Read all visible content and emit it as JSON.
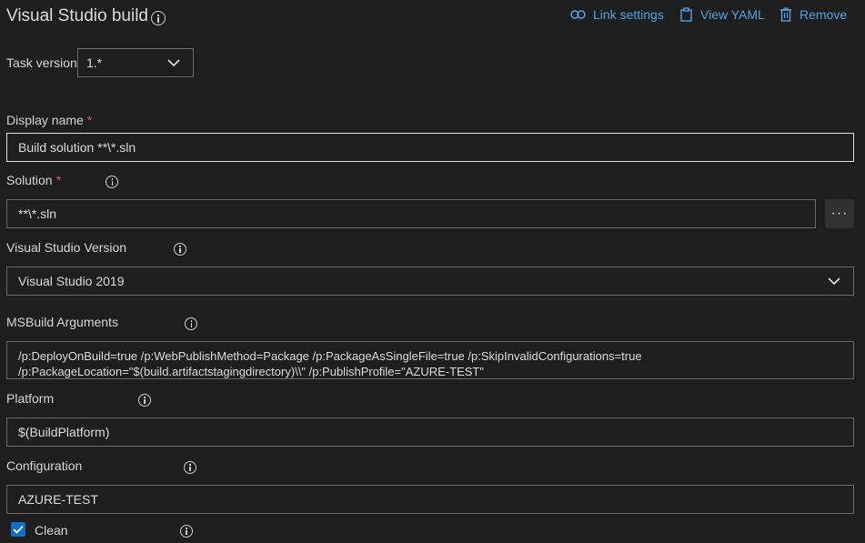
{
  "header": {
    "title": "Visual Studio build",
    "link_settings": "Link settings",
    "view_yaml": "View YAML",
    "remove": "Remove"
  },
  "task_version": {
    "label": "Task version",
    "value": "1.*"
  },
  "display_name": {
    "label": "Display name",
    "required": "*",
    "value": "Build solution **\\*.sln"
  },
  "solution": {
    "label": "Solution",
    "required": "*",
    "value": "**\\*.sln",
    "browse": "···"
  },
  "vs_version": {
    "label": "Visual Studio Version",
    "value": "Visual Studio 2019"
  },
  "msbuild": {
    "label": "MSBuild Arguments",
    "line1": "/p:DeployOnBuild=true /p:WebPublishMethod=Package /p:PackageAsSingleFile=true /p:SkipInvalidConfigurations=true",
    "line2": "/p:PackageLocation=\"$(build.artifactstagingdirectory)\\\\\"  /p:PublishProfile=\"AZURE-TEST\""
  },
  "platform": {
    "label": "Platform",
    "value": "$(BuildPlatform)"
  },
  "configuration": {
    "label": "Configuration",
    "value": "AZURE-TEST"
  },
  "clean": {
    "label": "Clean",
    "checked": true
  },
  "colors": {
    "accent": "#4fa3e8",
    "checkbox": "#0e6fc4",
    "required": "#e05a5a",
    "background": "#1e1e1e"
  }
}
